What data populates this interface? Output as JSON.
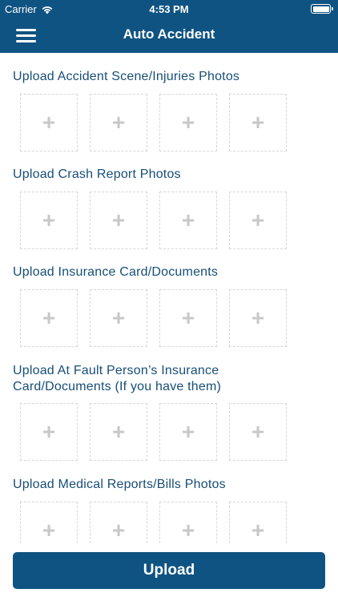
{
  "status_bar": {
    "carrier": "Carrier",
    "time": "4:53 PM",
    "wifi_icon": "wifi-icon",
    "battery_icon": "battery-icon"
  },
  "header": {
    "title": "Auto Accident",
    "menu_icon": "menu-icon",
    "background": "#0f5382"
  },
  "sections": [
    {
      "title": "Upload Accident Scene/Injuries Photos",
      "slots": [
        "+",
        "+",
        "+",
        "+"
      ]
    },
    {
      "title": "Upload Crash Report Photos",
      "slots": [
        "+",
        "+",
        "+",
        "+"
      ]
    },
    {
      "title": "Upload Insurance Card/Documents",
      "slots": [
        "+",
        "+",
        "+",
        "+"
      ]
    },
    {
      "title": "Upload At Fault Person’s Insurance Card/Documents (If you have them)",
      "slots": [
        "+",
        "+",
        "+",
        "+"
      ]
    },
    {
      "title": "Upload Medical Reports/Bills Photos",
      "slots": [
        "+",
        "+",
        "+",
        "+"
      ]
    }
  ],
  "upload_button": {
    "label": "Upload",
    "background": "#0f5382"
  },
  "colors": {
    "accent": "#0f5382",
    "section_title": "#174e77",
    "slot_border": "#d6d6d6",
    "plus": "#c8c8c8"
  }
}
